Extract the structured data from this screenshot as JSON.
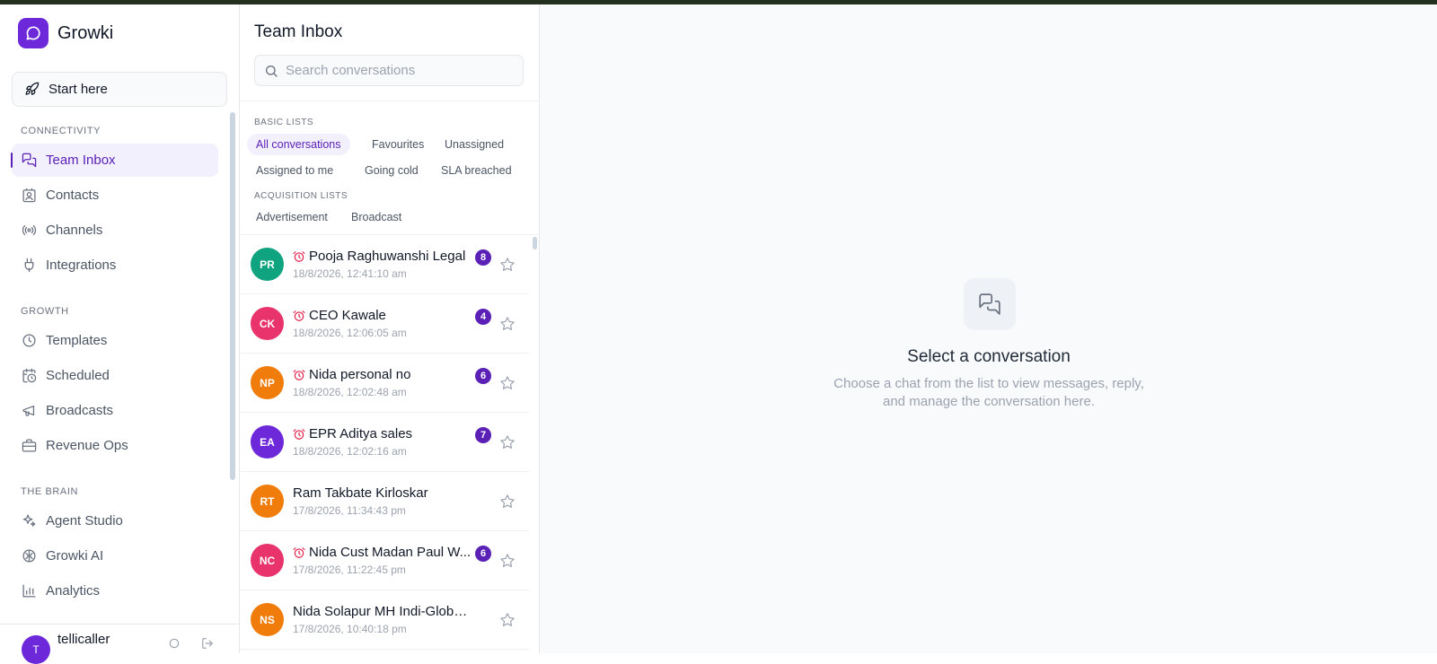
{
  "brand": {
    "name": "Growki",
    "accent": "#6d28d9"
  },
  "sidebar": {
    "start_label": "Start here",
    "sections": [
      {
        "title": "CONNECTIVITY",
        "items": [
          {
            "label": "Team Inbox",
            "icon": "chat-bubbles-icon",
            "active": true
          },
          {
            "label": "Contacts",
            "icon": "contact-card-icon"
          },
          {
            "label": "Channels",
            "icon": "broadcast-signal-icon"
          },
          {
            "label": "Integrations",
            "icon": "plug-icon"
          }
        ]
      },
      {
        "title": "GROWTH",
        "items": [
          {
            "label": "Templates",
            "icon": "clock-icon"
          },
          {
            "label": "Scheduled",
            "icon": "calendar-clock-icon"
          },
          {
            "label": "Broadcasts",
            "icon": "megaphone-icon"
          },
          {
            "label": "Revenue Ops",
            "icon": "briefcase-icon"
          }
        ]
      },
      {
        "title": "THE BRAIN",
        "items": [
          {
            "label": "Agent Studio",
            "icon": "sparkles-icon"
          },
          {
            "label": "Growki AI",
            "icon": "brain-icon"
          },
          {
            "label": "Analytics",
            "icon": "bar-chart-icon"
          }
        ]
      }
    ],
    "user": {
      "initial": "T",
      "name": "tellicaller"
    }
  },
  "inbox": {
    "title": "Team Inbox",
    "search_placeholder": "Search conversations",
    "basic_lists_title": "BASIC LISTS",
    "basic_lists": [
      "All conversations",
      "Favourites",
      "Unassigned",
      "Assigned to me",
      "Going cold",
      "SLA breached"
    ],
    "acquisition_lists_title": "ACQUISITION LISTS",
    "acquisition_lists": [
      "Advertisement",
      "Broadcast"
    ],
    "conversations": [
      {
        "initials": "PR",
        "name": "Pooja Raghuwanshi Legal",
        "time": "18/8/2026, 12:41:10 am",
        "unread": "8",
        "alarm": true,
        "color": "#10a37f"
      },
      {
        "initials": "CK",
        "name": "CEO Kawale",
        "time": "18/8/2026, 12:06:05 am",
        "unread": "4",
        "alarm": true,
        "color": "#e8336d"
      },
      {
        "initials": "NP",
        "name": "Nida personal no",
        "time": "18/8/2026, 12:02:48 am",
        "unread": "6",
        "alarm": true,
        "color": "#f07c0c"
      },
      {
        "initials": "EA",
        "name": "EPR Aditya sales",
        "time": "18/8/2026, 12:02:16 am",
        "unread": "7",
        "alarm": true,
        "color": "#6d28d9"
      },
      {
        "initials": "RT",
        "name": "Ram Takbate Kirloskar",
        "time": "17/8/2026, 11:34:43 pm",
        "unread": "",
        "alarm": false,
        "color": "#f07c0c"
      },
      {
        "initials": "NC",
        "name": "Nida Cust Madan Paul W...",
        "time": "17/8/2026, 11:22:45 pm",
        "unread": "6",
        "alarm": true,
        "color": "#e8336d"
      },
      {
        "initials": "NS",
        "name": "Nida Solapur MH Indi-Global M...",
        "time": "17/8/2026, 10:40:18 pm",
        "unread": "",
        "alarm": false,
        "color": "#f07c0c"
      }
    ]
  },
  "empty_state": {
    "title": "Select a conversation",
    "desc_line1": "Choose a chat from the list to view messages, reply,",
    "desc_line2": "and manage the conversation here."
  }
}
